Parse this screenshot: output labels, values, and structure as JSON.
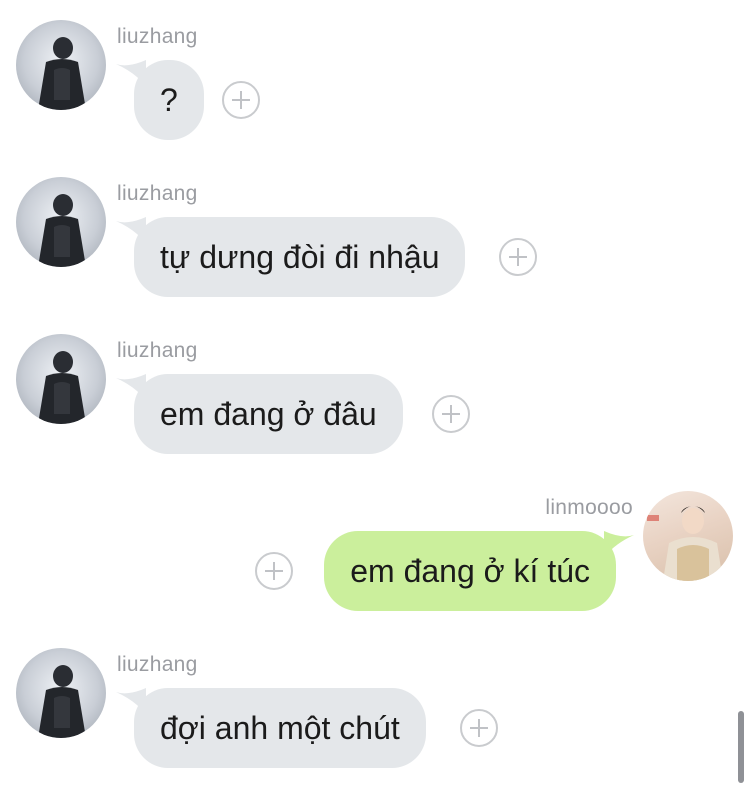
{
  "messages": [
    {
      "sender": "liuzhang",
      "text": "?",
      "side": "incoming"
    },
    {
      "sender": "liuzhang",
      "text": "tự dưng đòi đi nhậu",
      "side": "incoming"
    },
    {
      "sender": "liuzhang",
      "text": "em đang ở đâu",
      "side": "incoming"
    },
    {
      "sender": "linmoooo",
      "text": "em đang ở kí túc",
      "side": "outgoing"
    },
    {
      "sender": "liuzhang",
      "text": "đợi anh một chút",
      "side": "incoming"
    }
  ],
  "colors": {
    "incoming_bubble": "#e4e7ea",
    "outgoing_bubble": "#cbef9c",
    "sender_name": "#9a9ca1",
    "add_button": "#c9cbce"
  },
  "icons": {
    "add": "plus-circle-icon",
    "avatar": "profile-photo"
  }
}
